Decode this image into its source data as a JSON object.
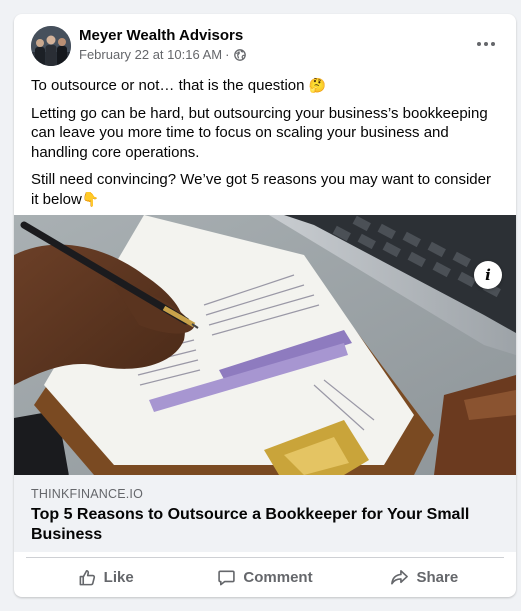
{
  "post": {
    "author": "Meyer Wealth Advisors",
    "timestamp": "February 22 at 10:16 AM",
    "separator": "·",
    "audience_icon": "globe-icon",
    "paragraphs": [
      "To outsource or not… that is the question",
      "Letting go can be hard, but outsourcing your business’s bookkeeping can leave you more time to focus on scaling your business and handling core operations.",
      "Still need convincing? We’ve got 5 reasons you may want to consider it below"
    ],
    "emoji_1": "🤔",
    "emoji_2": "👇"
  },
  "link": {
    "domain": "THINKFINANCE.IO",
    "title": "Top 5 Reasons to Outsource a Bookkeeper for Your Small Business",
    "info_label": "i"
  },
  "actions": {
    "like": "Like",
    "comment": "Comment",
    "share": "Share"
  },
  "colors": {
    "background": "#f0f2f5",
    "card": "#ffffff",
    "secondary_text": "#65676b",
    "primary_text": "#050505"
  }
}
